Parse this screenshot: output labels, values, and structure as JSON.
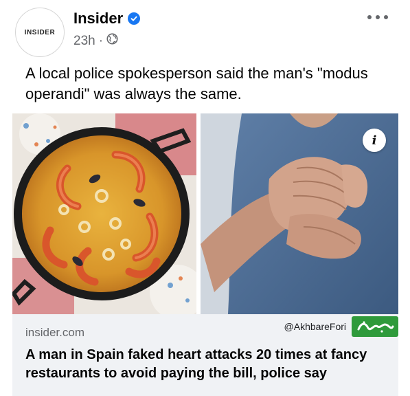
{
  "header": {
    "avatar_text": "INSIDER",
    "page_name": "Insider",
    "timestamp": "23h",
    "separator": "·",
    "privacy_icon": "globe-icon",
    "verified_icon": "verified-badge-icon",
    "more_icon": "more-options-icon"
  },
  "post": {
    "caption": "A local police spokesperson said the man's \"modus operandi\" was always the same."
  },
  "images": {
    "left": "paella-photo",
    "right": "chest-clutching-photo",
    "info_label": "i"
  },
  "link_preview": {
    "domain": "insider.com",
    "headline": "A man in Spain faked heart attacks 20 times at fancy restaurants to avoid paying the bill, police say"
  },
  "watermark": {
    "handle": "@AkhbareFori",
    "logo_text": "خبرفوری",
    "logo_color": "#2f9a3b"
  },
  "colors": {
    "verified": "#1877f2",
    "secondary_text": "#65676b",
    "link_bg": "#f0f2f5"
  }
}
